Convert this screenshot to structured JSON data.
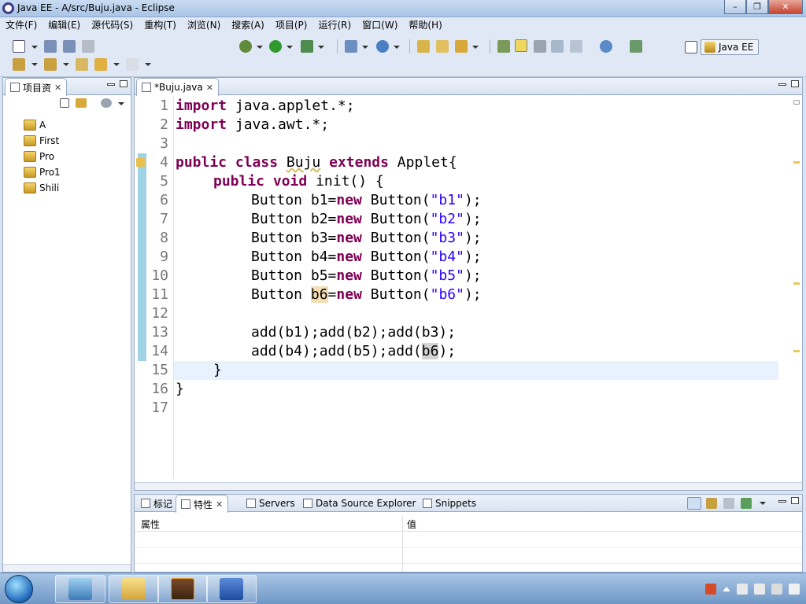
{
  "window": {
    "title": "Java EE  -  A/src/Buju.java  -  Eclipse",
    "minimize": "–",
    "maximize": "❐",
    "close": "✕"
  },
  "menu": [
    "文件(F)",
    "编辑(E)",
    "源代码(S)",
    "重构(T)",
    "浏览(N)",
    "搜索(A)",
    "项目(P)",
    "运行(R)",
    "窗口(W)",
    "帮助(H)"
  ],
  "perspective": {
    "label": "Java EE"
  },
  "project_explorer": {
    "tab_label": "项目资",
    "projects": [
      "A",
      "First",
      "Pro",
      "Pro1",
      "Shili"
    ]
  },
  "editor": {
    "tab_label": "*Buju.java",
    "line_numbers": [
      "1",
      "2",
      "3",
      "4",
      "5",
      "6",
      "7",
      "8",
      "9",
      "10",
      "11",
      "12",
      "13",
      "14",
      "15",
      "16",
      "17"
    ],
    "code": {
      "l1_kw": "import",
      "l1_rest": " java.applet.*;",
      "l2_kw": "import",
      "l2_rest": " java.awt.*;",
      "l4_kw1": "public",
      "l4_kw2": "class",
      "l4_name": "Buju",
      "l4_kw3": "extends",
      "l4_rest": " Applet{",
      "l5_kw1": "public",
      "l5_kw2": "void",
      "l5_rest": " init() {",
      "buttons": [
        {
          "decl": "Button b1=",
          "kw": "new",
          "call": " Button(",
          "str": "\"b1\"",
          "end": ");"
        },
        {
          "decl": "Button b2=",
          "kw": "new",
          "call": " Button(",
          "str": "\"b2\"",
          "end": ");"
        },
        {
          "decl": "Button b3=",
          "kw": "new",
          "call": " Button(",
          "str": "\"b3\"",
          "end": ");"
        },
        {
          "decl": "Button b4=",
          "kw": "new",
          "call": " Button(",
          "str": "\"b4\"",
          "end": ");"
        },
        {
          "decl": "Button b5=",
          "kw": "new",
          "call": " Button(",
          "str": "\"b5\"",
          "end": ");"
        }
      ],
      "l11_pre": "Button ",
      "l11_var": "b6",
      "l11_eq": "=",
      "l11_kw": "new",
      "l11_call": " Button(",
      "l11_str": "\"b6\"",
      "l11_end": ");",
      "l13": "add(b1);add(b2);add(b3);",
      "l14_pre": "add(b4);add(b5);add(",
      "l14_var": "b6",
      "l14_end": ");",
      "l15": "}",
      "l16": "}"
    }
  },
  "bottom_views": {
    "tabs": [
      "标记",
      "特性",
      "Servers",
      "Data Source Explorer",
      "Snippets"
    ],
    "columns": [
      "属性",
      "值"
    ]
  },
  "colors": {
    "keyword": "#7f0055",
    "string": "#2a00ff",
    "current_line": "#e8f2fe"
  },
  "taskbar": {
    "apps": [
      "start-orb",
      "desktop",
      "explorer",
      "java-ee-ide",
      "word"
    ]
  }
}
